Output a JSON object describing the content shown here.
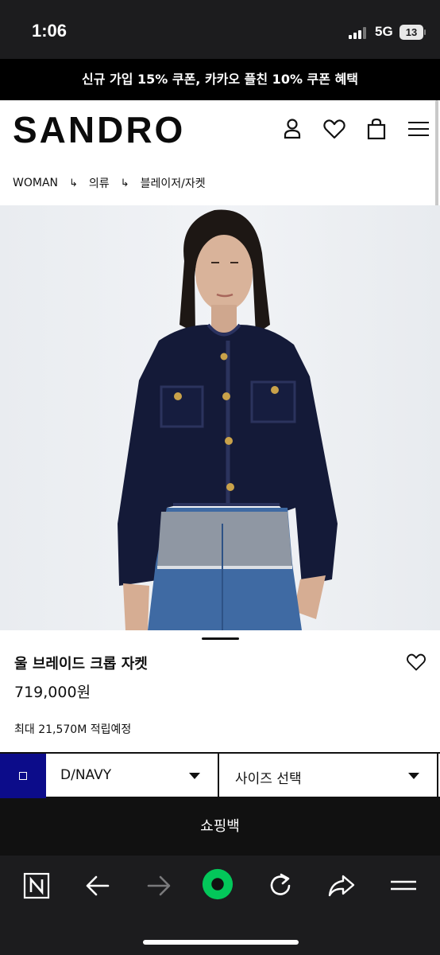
{
  "status": {
    "time": "1:06",
    "network": "5G",
    "battery": "13"
  },
  "promo": {
    "text": "신규 가입 15% 쿠폰, 카카오 플친 10% 쿠폰 혜택"
  },
  "header": {
    "logo": "SANDRO",
    "icons": [
      "user-icon",
      "heart-icon",
      "shopping-bag-icon",
      "menu-icon"
    ]
  },
  "breadcrumb": {
    "separator": "↳",
    "items": [
      "WOMAN",
      "의류",
      "블레이저/자켓"
    ]
  },
  "gallery": {
    "image_count": 7,
    "active_index": 5
  },
  "product": {
    "name": "울 브레이드 크롭 자켓",
    "price": "719,000원",
    "points": "최대 21,570M 적립예정"
  },
  "options": {
    "color_value": "D/NAVY",
    "swatch_color": "#0c0c8a",
    "size_placeholder": "사이즈 선택"
  },
  "cart": {
    "label": "쇼핑백"
  },
  "browser_toolbar": {
    "icons": [
      "naver-n-icon",
      "back-arrow-icon",
      "forward-arrow-icon",
      "green-dot-icon",
      "reload-icon",
      "share-icon",
      "menu-lines-icon"
    ],
    "accent": "#03c75a"
  }
}
